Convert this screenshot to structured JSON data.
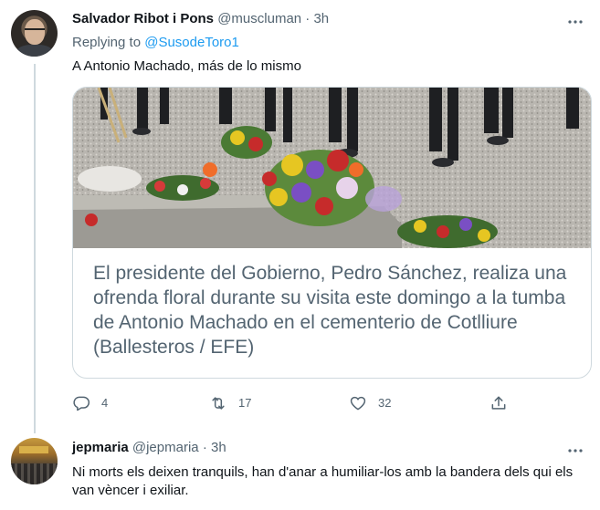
{
  "tweet1": {
    "author_name": "Salvador Ribot i Pons",
    "author_handle": "@muscluman",
    "separator": "·",
    "time": "3h",
    "replying_label": "Replying to ",
    "replying_to": "@SusodeToro1",
    "text": "A Antonio Machado, más de lo mismo",
    "card_caption": "El presidente del Gobierno, Pedro Sánchez, realiza una ofrenda floral durante su visita este domingo a la tumba de Antonio Machado en el cementerio de Cotlliure (Ballesteros / EFE)",
    "actions": {
      "reply_count": "4",
      "retweet_count": "17",
      "like_count": "32",
      "share_label": ""
    },
    "icons": [
      "more-icon",
      "reply-icon",
      "retweet-icon",
      "like-icon",
      "share-icon"
    ]
  },
  "tweet2": {
    "author_name": "jepmaria",
    "author_handle": "@jepmaria",
    "separator": "·",
    "time": "3h",
    "text": "Ni morts els deixen tranquils, han d'anar a humiliar-los amb la bandera dels qui els van vèncer i exiliar.",
    "icons": [
      "more-icon"
    ]
  },
  "colors": {
    "text_primary": "#0f1419",
    "text_secondary": "#536471",
    "link": "#1d9bf0",
    "border": "#cfd9de"
  }
}
